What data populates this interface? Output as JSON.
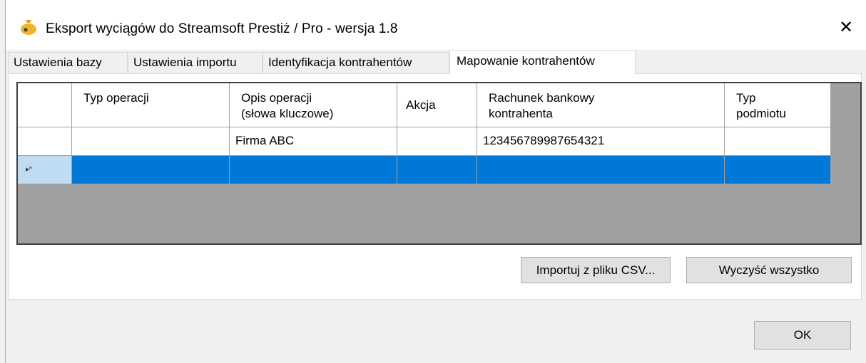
{
  "window": {
    "title": "Eksport wyciągów do Streamsoft Prestiż / Pro - wersja 1.8",
    "close_glyph": "✕"
  },
  "tabs": [
    {
      "label": "Ustawienia bazy"
    },
    {
      "label": "Ustawienia importu"
    },
    {
      "label": "Identyfikacja kontrahentów"
    },
    {
      "label": "Mapowanie kontrahentów",
      "active": true
    }
  ],
  "grid": {
    "columns": [
      {
        "line1": "Typ operacji",
        "line2": ""
      },
      {
        "line1": "Opis operacji",
        "line2": "(słowa kluczowe)"
      },
      {
        "line1": "Akcja",
        "line2": ""
      },
      {
        "line1": "Rachunek bankowy",
        "line2": "kontrahenta"
      },
      {
        "line1": "Typ",
        "line2": "podmiotu"
      }
    ],
    "rows": [
      {
        "typ": "",
        "opis": "Firma ABC",
        "akcja": "",
        "rachunek": "123456789987654321",
        "podmiot": ""
      }
    ],
    "new_row_marker": "▸*"
  },
  "buttons": {
    "import_csv": "Importuj z pliku CSV...",
    "clear_all": "Wyczyść wszystko",
    "ok": "OK"
  },
  "colors": {
    "selection": "#0078d7",
    "grid_background": "#a0a0a0"
  }
}
